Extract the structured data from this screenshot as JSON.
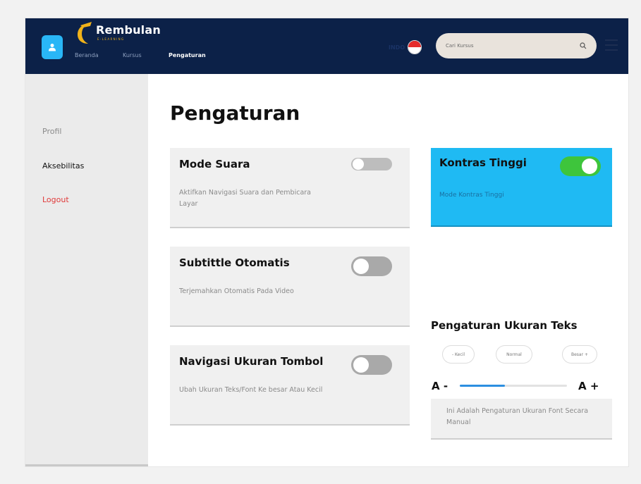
{
  "header": {
    "logo_title": "Rembulan",
    "logo_subtitle": "E-LEARNING",
    "nav": [
      {
        "label": "Beranda"
      },
      {
        "label": "Kursus"
      },
      {
        "label": "Pengaturan"
      }
    ],
    "lang_label": "INDO",
    "search_placeholder": "Cari Kursus"
  },
  "sidebar": {
    "items": [
      {
        "label": "Profil"
      },
      {
        "label": "Aksebilitas"
      },
      {
        "label": "Logout"
      }
    ]
  },
  "main": {
    "title": "Pengaturan",
    "cards": [
      {
        "title": "Mode Suara",
        "desc": "Aktifkan Navigasi Suara dan Pembicara Layar",
        "enabled": false
      },
      {
        "title": "Subtittle Otomatis",
        "desc": "Terjemahkan Otomatis Pada Video",
        "enabled": false
      },
      {
        "title": "Navigasi Ukuran Tombol",
        "desc": "Ubah Ukuran Teks/Font Ke besar Atau Kecil",
        "enabled": false
      }
    ],
    "contrast": {
      "title": "Kontras Tinggi",
      "desc": "Mode Kontras Tinggi",
      "enabled": true
    },
    "text_size": {
      "title": "Pengaturan Ukuran Teks",
      "options": [
        "- Kecil",
        "Normal",
        "Besar +"
      ],
      "a_minus": "A -",
      "a_plus": "A +",
      "slider_fraction": 0.42,
      "manual_text": "Ini Adalah Pengaturan Ukuran Font Secara Manual"
    }
  },
  "colors": {
    "header_bg": "#0c2148",
    "accent_blue": "#1fbaf3",
    "toggle_on": "#3ec53c",
    "logout_red": "#e03a3a"
  }
}
